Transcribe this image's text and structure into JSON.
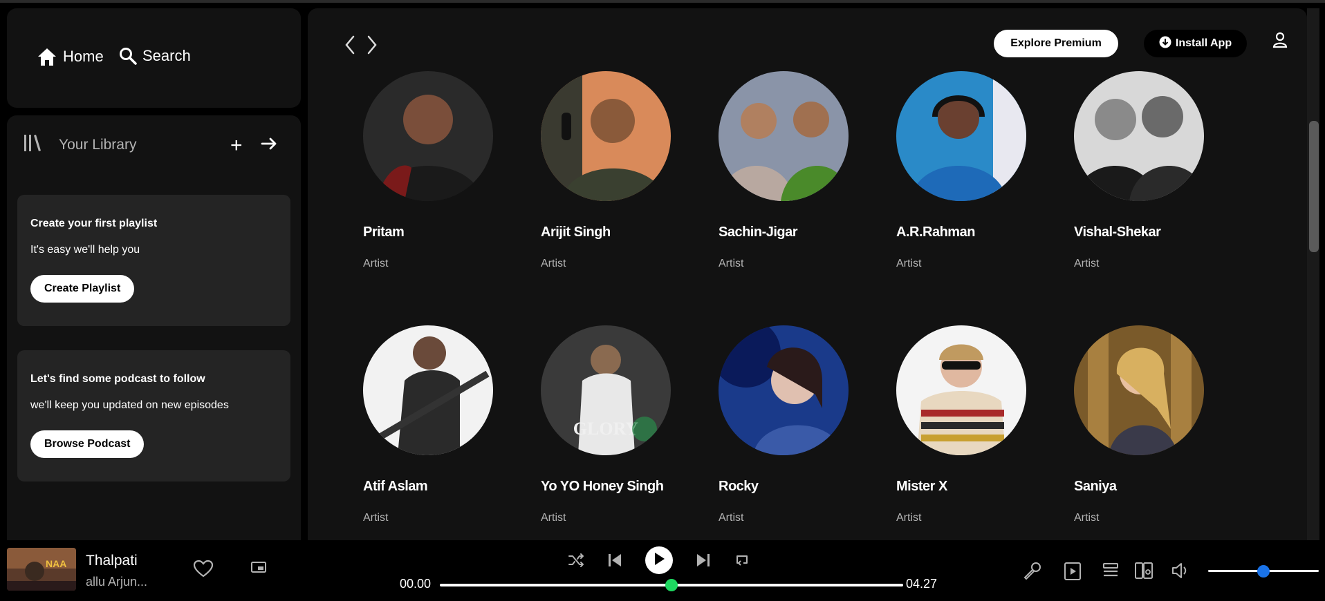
{
  "nav": {
    "home": "Home",
    "search": "Search"
  },
  "library": {
    "title": "Your Library",
    "plus": "+",
    "playlist_card": {
      "title": "Create your first playlist",
      "subtitle": "It's easy we'll help you",
      "button": "Create Playlist"
    },
    "podcast_card": {
      "title": "Let's find some podcast to follow",
      "subtitle": "we'll keep you updated on new episodes",
      "button": "Browse Podcast"
    }
  },
  "header": {
    "premium": "Explore Premium",
    "install": "Install App"
  },
  "artists": [
    {
      "name": "Pritam",
      "type": "Artist",
      "bg": "#4a2a2a"
    },
    {
      "name": "Arijit Singh",
      "type": "Artist",
      "bg": "#d98a5a"
    },
    {
      "name": "Sachin-Jigar",
      "type": "Artist",
      "bg": "#8a94a8"
    },
    {
      "name": "A.R.Rahman",
      "type": "Artist",
      "bg": "#2a8ac8"
    },
    {
      "name": "Vishal-Shekar",
      "type": "Artist",
      "bg": "#d8d8d8"
    },
    {
      "name": "Atif Aslam",
      "type": "Artist",
      "bg": "#f2f2f2"
    },
    {
      "name": "Yo YO Honey Singh",
      "type": "Artist",
      "bg": "#3a3a3a"
    },
    {
      "name": "Rocky",
      "type": "Artist",
      "bg": "#1a3a8a"
    },
    {
      "name": "Mister X",
      "type": "Artist",
      "bg": "#f4f4f4"
    },
    {
      "name": "Saniya",
      "type": "Artist",
      "bg": "#7a5a2a"
    }
  ],
  "player": {
    "title": "Thalpati",
    "artist": "allu Arjun...",
    "time_current": "00.00",
    "time_total": "04.27",
    "progress": 0.5,
    "volume": 0.45
  }
}
